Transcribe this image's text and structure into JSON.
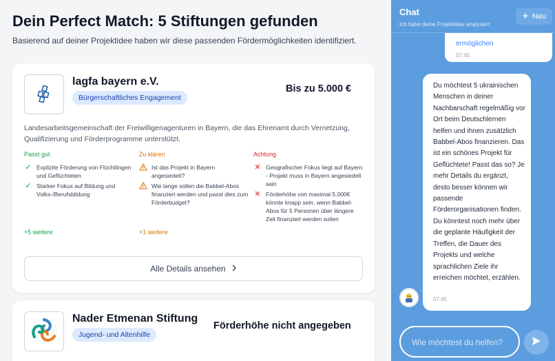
{
  "main": {
    "title": "Dein Perfect Match: 5 Stiftungen gefunden",
    "subtitle": "Basierend auf deiner Projektidee haben wir diese passenden Fördermöglichkeiten identifiziert."
  },
  "cards": [
    {
      "logo_icon": "lagfa-logo-icon",
      "name": "lagfa bayern e.V.",
      "badge": "Bürgerschaftliches Engagement",
      "amount": "Bis zu 5.000 €",
      "description": "Landesarbeitsgemeinschaft der Freiwilligenagenturen in Bayern, die das Ehrenamt durch Vernetzung, Qualifizierung und Förderprogramme unterstützt.",
      "fits": {
        "heading": "Passt gut",
        "items": [
          "Explizite Förderung von Flüchtlingen und Geflüchteten",
          "Starker Fokus auf Bildung und Volks-/Berufsbildung"
        ],
        "more": "+5 weitere"
      },
      "clarify": {
        "heading": "Zu klären",
        "items": [
          "Ist das Projekt in Bayern angesiedelt?",
          "Wie lange sollen die Babbel-Abos finanziert werden und passt dies zum Förderbudget?"
        ],
        "more": "+1 weitere"
      },
      "caution": {
        "heading": "Achtung",
        "items": [
          "Geografischer Fokus liegt auf Bayern - Projekt muss in Bayern angesiedelt sein",
          "Förderhöhe von maximal 5.000€ könnte knapp sein, wenn Babbel-Abos für 5 Personen über längere Zeit finanziert werden sollen"
        ]
      },
      "details_button": "Alle Details ansehen"
    },
    {
      "logo_icon": "foundation-logo-icon",
      "name": "Nader Etmenan Stiftung",
      "badge": "Jugend- und Altenhilfe",
      "amount": "Förderhöhe nicht angegeben"
    }
  ],
  "chat": {
    "title": "Chat",
    "subtitle": "Ich habe deine Projektidee analysiert",
    "new_button": "Neu",
    "messages": [
      {
        "role": "user",
        "text": "ermöglichen",
        "time": "07:45"
      },
      {
        "role": "assistant",
        "text": "Du möchtest 5 ukrainischen Menschen in deiner Nachbarschaft regelmäßig vor Ort beim Deutschlernen helfen und ihnen zusätzlich Babbel-Abos finanzieren. Das ist ein schönes Projekt für Geflüchtete! Passt das so? Je mehr Details du ergänzt, desto besser können wir passende Förderorganisationen finden. Du könntest noch mehr über die geplante Häufigkeit der Treffen, die Dauer des Projekts und welche sprachlichen Ziele ihr erreichen möchtet, erzählen.",
        "time": "07:45"
      }
    ],
    "input_placeholder": "Wie möchtest du helfen?"
  },
  "colors": {
    "chat_bg": "#5b9ddf",
    "badge_bg": "#dbeafe",
    "badge_text": "#1e40af",
    "fit": "#16a34a",
    "clarify": "#d97706",
    "caution": "#dc2626"
  }
}
